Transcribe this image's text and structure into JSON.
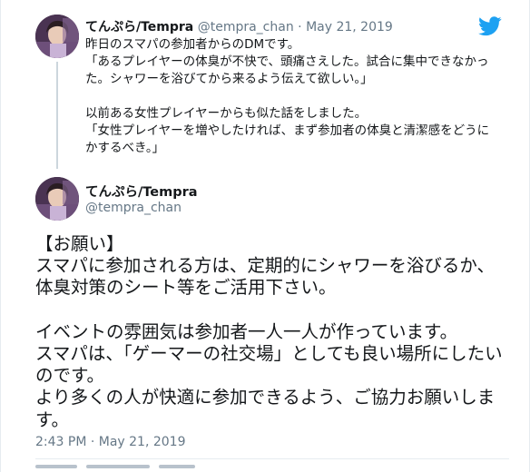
{
  "parent_tweet": {
    "display_name": "てんぷら/Tempra",
    "handle": "@tempra_chan",
    "separator": "·",
    "date": "May 21, 2019",
    "text": "昨日のスマパの参加者からのDMです。\n「あるプレイヤーの体臭が不快で、頭痛さえした。試合に集中できなかった。シャワーを浴びてから来るよう伝えて欲しい。」\n\n以前ある女性プレイヤーからも似た話をしました。\n「女性プレイヤーを増やしたければ、まず参加者の体臭と清潔感をどうにかするべき。」"
  },
  "main_tweet": {
    "display_name": "てんぷら/Tempra",
    "handle": "@tempra_chan",
    "text": "【お願い】\nスマパに参加される方は、定期的にシャワーを浴びるか、体臭対策のシート等をご活用下さい。\n\nイベントの雰囲気は参加者一人一人が作っています。\nスマパは、「ゲーマーの社交場」としても良い場所にしたいのです。\nより多くの人が快適に参加できるよう、ご協力お願いします。",
    "timestamp": "2:43 PM · May 21, 2019"
  },
  "icons": {
    "brand": "twitter-bird-icon",
    "brand_color": "#1da1f2"
  }
}
